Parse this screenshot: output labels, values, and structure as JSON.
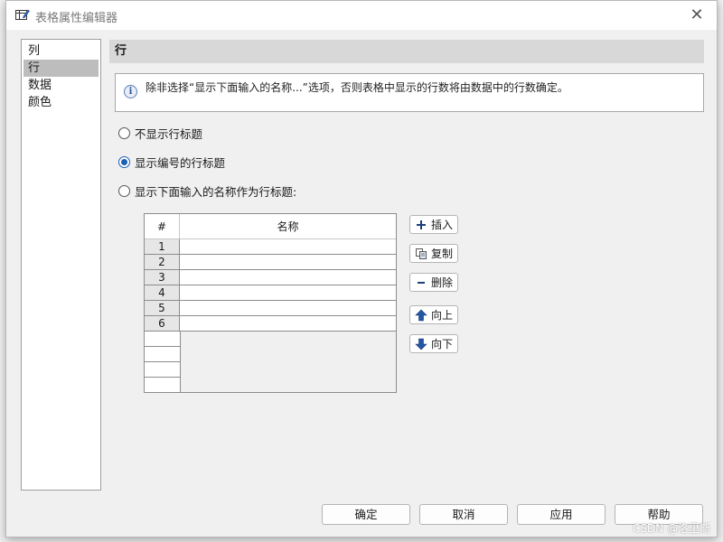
{
  "window": {
    "title": "表格属性编辑器",
    "close_glyph": "✕"
  },
  "nav": {
    "items": [
      {
        "label": "列"
      },
      {
        "label": "行"
      },
      {
        "label": "数据"
      },
      {
        "label": "颜色"
      }
    ],
    "selected": "行"
  },
  "section": {
    "title": "行"
  },
  "info": {
    "glyph": "i",
    "text": "除非选择“显示下面输入的名称...”选项，否则表格中显示的行数将由数据中的行数确定。"
  },
  "options": [
    {
      "label": "不显示行标题",
      "checked": false
    },
    {
      "label": "显示编号的行标题",
      "checked": true
    },
    {
      "label": "显示下面输入的名称作为行标题:",
      "checked": false
    }
  ],
  "grid": {
    "col_num": "#",
    "col_name": "名称",
    "rows": [
      "1",
      "2",
      "3",
      "4",
      "5",
      "6"
    ],
    "empty_rows": 4
  },
  "side_buttons": {
    "insert": "插入",
    "copy": "复制",
    "delete": "删除",
    "up": "向上",
    "down": "向下"
  },
  "bottom_buttons": {
    "ok": "确定",
    "cancel": "取消",
    "apply": "应用",
    "help": "帮助"
  },
  "watermark": "CSDN @洛里斯",
  "colors": {
    "accent": "#1a5fb4",
    "selected_nav": "#bdbdbd",
    "header_band": "#d8d8d8",
    "arrow_blue": "#2456a6"
  }
}
